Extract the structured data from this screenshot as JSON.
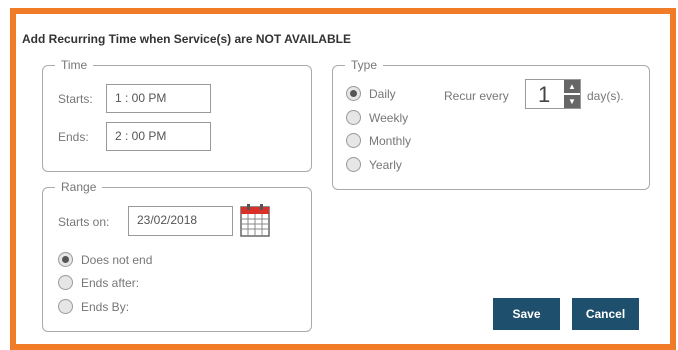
{
  "dialog": {
    "title": "Add Recurring Time when Service(s) are NOT AVAILABLE"
  },
  "time": {
    "legend": "Time",
    "starts_label": "Starts:",
    "starts_value": "1 : 00 PM",
    "ends_label": "Ends:",
    "ends_value": "2 : 00 PM"
  },
  "type": {
    "legend": "Type",
    "options": [
      "Daily",
      "Weekly",
      "Monthly",
      "Yearly"
    ],
    "selected": "Daily",
    "recur_label": "Recur every",
    "recur_value": "1",
    "recur_unit": "day(s)."
  },
  "range": {
    "legend": "Range",
    "starts_on_label": "Starts on:",
    "starts_on_value": "23/02/2018",
    "options": [
      "Does not end",
      "Ends after:",
      "Ends By:"
    ],
    "selected": "Does not end",
    "calendar_icon": "calendar-icon"
  },
  "buttons": {
    "save_label": "Save",
    "cancel_label": "Cancel"
  },
  "colors": {
    "border_accent": "#f07c28",
    "button_bg": "#1e4f6d"
  }
}
